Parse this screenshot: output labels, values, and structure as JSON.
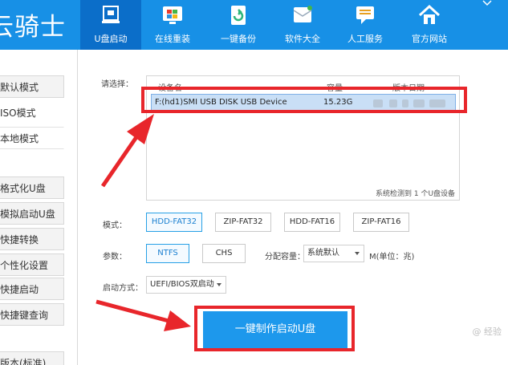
{
  "brand": {
    "title": "云骑士"
  },
  "nav": [
    {
      "label": "U盘启动",
      "icon": "usb-icon",
      "active": true
    },
    {
      "label": "在线重装",
      "icon": "windows-icon"
    },
    {
      "label": "一键备份",
      "icon": "backup-icon"
    },
    {
      "label": "软件大全",
      "icon": "software-icon"
    },
    {
      "label": "人工服务",
      "icon": "chat-icon"
    },
    {
      "label": "官方网站",
      "icon": "home-icon"
    }
  ],
  "sidebar": {
    "items": [
      {
        "label": "默认模式"
      },
      {
        "label": "ISO模式"
      },
      {
        "label": "本地模式"
      },
      {
        "label": "格式化U盘"
      },
      {
        "label": "模拟启动U盘"
      },
      {
        "label": "快捷转换"
      },
      {
        "label": "个性化设置"
      },
      {
        "label": "快捷启动"
      },
      {
        "label": "快捷键查询"
      },
      {
        "label": "版本(标准)"
      }
    ]
  },
  "main": {
    "select_label": "请选择：",
    "table": {
      "headers": [
        "设备名",
        "容量",
        "版本日期"
      ],
      "rows": [
        {
          "device": "F:(hd1)SMI USB DISK USB Device",
          "capacity": "15.23G"
        }
      ]
    },
    "detect_text": "系统检测到 1 个U盘设备",
    "mode_label": "模式：",
    "modes": [
      "HDD-FAT32",
      "ZIP-FAT32",
      "HDD-FAT16",
      "ZIP-FAT16"
    ],
    "param_label": "参数：",
    "params": [
      "NTFS",
      "CHS"
    ],
    "alloc_label": "分配容量：",
    "alloc_value": "系统默认",
    "alloc_unit": "M(单位：兆)",
    "boot_label": "启动方式：",
    "boot_value": "UEFI/BIOS双启动",
    "make_button": "一键制作启动U盘"
  },
  "watermark": "@ 经验",
  "colors": {
    "header": "#1790e6",
    "accent": "#1d98ec",
    "annotation": "#e8262b"
  }
}
